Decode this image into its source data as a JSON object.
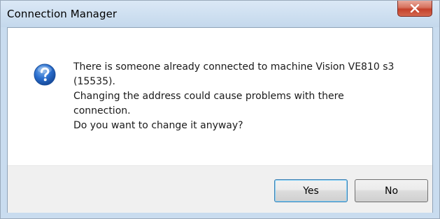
{
  "window": {
    "title": "Connection Manager"
  },
  "icons": {
    "message_icon": "question-icon",
    "close": "close-icon"
  },
  "message": {
    "lines": [
      "There is someone already connected to machine Vision VE810 s3",
      "(15535).",
      "Changing the address could cause problems with there",
      "connection.",
      "Do you want to change it anyway?"
    ]
  },
  "buttons": {
    "yes_label": "Yes",
    "no_label": "No"
  },
  "colors": {
    "titlebar": "#cfe0f1",
    "close_button": "#c4412b",
    "footer": "#f0f0f0",
    "default_button_border": "#3c7fb1"
  }
}
